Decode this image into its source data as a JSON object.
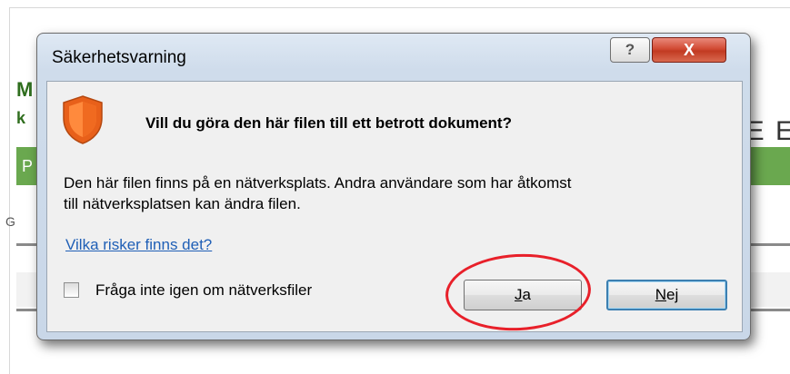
{
  "background": {
    "green_bar_text": "P",
    "left_letter_1": "M",
    "left_letter_2": "k",
    "right_text": "E E",
    "side_text": "G"
  },
  "dialog": {
    "title": "Säkerhetsvarning",
    "help_label": "?",
    "close_label": "X",
    "icon": "shield-icon",
    "question": "Vill du göra den här filen till ett betrott dokument?",
    "message_line_1": "Den här filen finns på en nätverksplats. Andra användare som har åtkomst",
    "message_line_2": "till nätverksplatsen kan ändra filen.",
    "risk_link": "Vilka risker finns det?",
    "checkbox": {
      "label_pre": "Frå",
      "label_accel": "g",
      "label_post": "a inte igen om nätverksfiler",
      "checked": false
    },
    "yes_button": {
      "accel": "J",
      "rest": "a"
    },
    "no_button": {
      "accel": "N",
      "rest": "ej"
    }
  },
  "colors": {
    "shield_orange": "#f07020",
    "annotation_red": "#e8202a",
    "link_blue": "#1f5fb6",
    "close_red": "#c13a22",
    "bg_green": "#6aa84f"
  }
}
